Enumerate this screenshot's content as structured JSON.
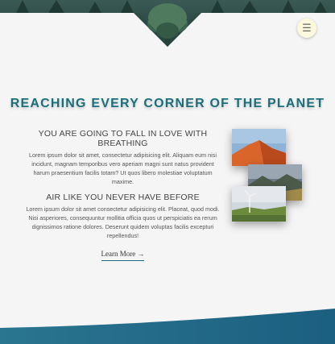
{
  "header": {
    "menu_icon": "☰"
  },
  "hero": {
    "title": "REACHING EVERY CORNER OF THE PLANET"
  },
  "sections": [
    {
      "title": "YOU ARE GOING TO FALL IN LOVE WITH BREATHING",
      "body": "Lorem ipsum dolor sit amet, consectetur adipisicing elit. Aliquam eum nisi incidunt, magnam temporibus vero aperiam magni sunt natus provident harum praesentium facilis totam? Ut quos libero molestiae voluptatum maxime."
    },
    {
      "title": "AIR LIKE YOU NEVER HAVE BEFORE",
      "body": "Lorem ipsum dolor sit amet consectetur adipisicing elit. Placeat, quod modi. Nisi asperiores, consequuntur mollitia officia quos ut perspiciatis ea rerum dignissimos ratione dolores. Deserunt quidem voluptas facilis excepturi repellendus!"
    }
  ],
  "cta": {
    "label": "Learn More →"
  },
  "colors": {
    "accent": "#1b6f7a",
    "menu_bg": "#fbf8dc",
    "background": "#f5f5f5"
  },
  "images": [
    {
      "name": "desert-dune-photo"
    },
    {
      "name": "mountain-valley-photo"
    },
    {
      "name": "wind-turbine-photo"
    }
  ]
}
